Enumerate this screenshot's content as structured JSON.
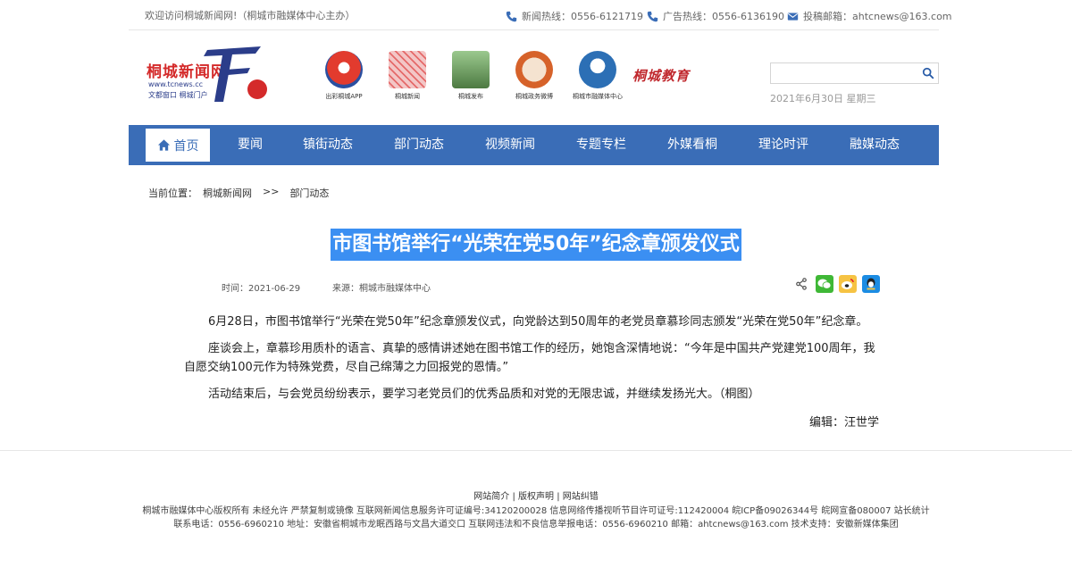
{
  "topbar": {
    "welcome": "欢迎访问桐城新闻网!（桐城市融媒体中心主办）",
    "news_hotline": "新闻热线：0556-6121719",
    "ad_hotline": "广告热线：0556-6136190",
    "email": "投稿邮箱：ahtcnews@163.com",
    "icons": [
      "phone-icon",
      "phone-icon",
      "mail-icon"
    ]
  },
  "logo": {
    "title": "桐城新闻网",
    "url": "www.tcnews.cc",
    "slogan": "文都窗口 桐城门户"
  },
  "media_links": [
    {
      "caption": "出彩桐城APP",
      "color": "#e23b2e"
    },
    {
      "caption": "桐城新闻",
      "color": "#f0b8b8"
    },
    {
      "caption": "桐城发布",
      "color": "#6aa45c"
    },
    {
      "caption": "桐城政务微博",
      "color": "#d6622a"
    },
    {
      "caption": "桐城市融媒体中心",
      "color": "#2c6fb5"
    }
  ],
  "brush_text": "桐城教育",
  "search": {
    "placeholder": "",
    "value": ""
  },
  "date": "2021年6月30日 星期三",
  "nav": {
    "home": "首页",
    "items": [
      "要闻",
      "镇街动态",
      "部门动态",
      "视频新闻",
      "专题专栏",
      "外媒看桐",
      "理论时评",
      "融媒动态"
    ],
    "bg_color": "#3a6db7"
  },
  "breadcrumb": {
    "label": "当前位置：",
    "site": "桐城新闻网",
    "sep": ">>",
    "current": "部门动态"
  },
  "article": {
    "title": "市图书馆举行“光荣在党50年”纪念章颁发仪式",
    "time": "时间：2021-06-29",
    "source": "来源：桐城市融媒体中心",
    "paragraphs": [
      "6月28日，市图书馆举行“光荣在党50年”纪念章颁发仪式，向党龄达到50周年的老党员章慕珍同志颁发“光荣在党50年”纪念章。",
      "座谈会上，章慕珍用质朴的语言、真挚的感情讲述她在图书馆工作的经历，她饱含深情地说：“今年是中国共产党建党100周年，我自愿交纳100元作为特殊党费，尽自己绵薄之力回报党的恩情。”",
      "活动结束后，与会党员纷纷表示，要学习老党员们的优秀品质和对党的无限忠诚，并继续发扬光大。（桐图）"
    ],
    "editor": "编辑：汪世学",
    "share_icons": [
      "share-icon",
      "wechat-icon",
      "weibo-icon",
      "qq-icon"
    ]
  },
  "footer": {
    "links": [
      "网站简介",
      "版权声明",
      "网站纠错"
    ],
    "line1": "桐城市融媒体中心版权所有 未经允许 严禁复制或镜像 互联网新闻信息服务许可证编号:34120200028 信息网络传播视听节目许可证号:112420004 皖ICP备09026344号 皖网宣备080007 站长统计",
    "line2": "联系电话：0556-6960210 地址：安徽省桐城市龙眠西路与文昌大道交口 互联网违法和不良信息举报电话：0556-6960210 邮箱：ahtcnews@163.com 技术支持：安徽新媒体集团"
  }
}
